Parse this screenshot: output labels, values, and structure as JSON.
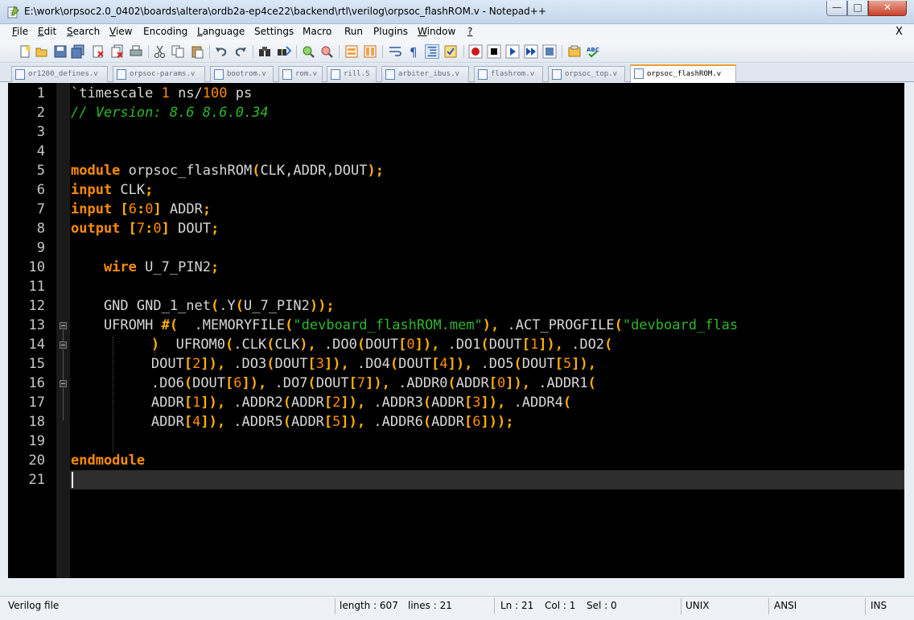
{
  "window": {
    "title": "E:\\work\\orpsoc2.0_0402\\boards\\altera\\ordb2a-ep4ce22\\backend\\rtl\\verilog\\orpsoc_flashROM.v - Notepad++",
    "min_label": "—",
    "max_label": "□",
    "close_label": "✕"
  },
  "menu": {
    "items": [
      {
        "u": "F",
        "rest": "ile"
      },
      {
        "u": "E",
        "rest": "dit"
      },
      {
        "u": "S",
        "rest": "earch"
      },
      {
        "u": "V",
        "rest": "iew"
      },
      {
        "u": "",
        "rest": "Encoding"
      },
      {
        "u": "L",
        "rest": "anguage"
      },
      {
        "u": "",
        "rest": "Settings"
      },
      {
        "u": "",
        "rest": "Macro"
      },
      {
        "u": "",
        "rest": "Run"
      },
      {
        "u": "",
        "rest": "Plugins"
      },
      {
        "u": "W",
        "rest": "indow"
      },
      {
        "u": "?",
        "rest": ""
      }
    ],
    "close": "X"
  },
  "tabs": [
    {
      "label": "or1200_defines.v"
    },
    {
      "label": "orpsoc-params.v"
    },
    {
      "label": "bootrom.v"
    },
    {
      "label": "rom.v"
    },
    {
      "label": "rill.S"
    },
    {
      "label": "arbiter_ibus.v"
    },
    {
      "label": "flashrom.v"
    },
    {
      "label": "orpsoc_top.v"
    },
    {
      "label": "orpsoc_flashROM.v"
    }
  ],
  "line_numbers": [
    "1",
    "2",
    "3",
    "4",
    "5",
    "6",
    "7",
    "8",
    "9",
    "10",
    "11",
    "12",
    "13",
    "14",
    "15",
    "16",
    "17",
    "18",
    "19",
    "20",
    "21"
  ],
  "code": {
    "l1": [
      [
        "`timescale ",
        "id"
      ],
      [
        "1",
        "num"
      ],
      [
        " ns/",
        "id"
      ],
      [
        "100",
        "num"
      ],
      [
        " ps",
        "id"
      ]
    ],
    "l2": [
      [
        "// Version: 8.6 8.6.0.34",
        "cmt"
      ]
    ],
    "l5": [
      [
        "module",
        "kw"
      ],
      [
        " orpsoc_flashROM",
        "id"
      ],
      [
        "(",
        "op"
      ],
      [
        "CLK,ADDR,DOUT",
        "id"
      ],
      [
        ")",
        "op"
      ],
      [
        ";",
        "op"
      ]
    ],
    "l6": [
      [
        "input",
        "kw"
      ],
      [
        " CLK",
        "id"
      ],
      [
        ";",
        "op"
      ]
    ],
    "l7": [
      [
        "input",
        "kw"
      ],
      [
        " ",
        "id"
      ],
      [
        "[",
        "op"
      ],
      [
        "6",
        "num"
      ],
      [
        ":",
        "op"
      ],
      [
        "0",
        "num"
      ],
      [
        "]",
        "op"
      ],
      [
        " ADDR",
        "id"
      ],
      [
        ";",
        "op"
      ]
    ],
    "l8": [
      [
        "output",
        "kw"
      ],
      [
        " ",
        "id"
      ],
      [
        "[",
        "op"
      ],
      [
        "7",
        "num"
      ],
      [
        ":",
        "op"
      ],
      [
        "0",
        "num"
      ],
      [
        "]",
        "op"
      ],
      [
        " DOUT",
        "id"
      ],
      [
        ";",
        "op"
      ]
    ],
    "l10": [
      [
        "    ",
        "id"
      ],
      [
        "wire",
        "kw"
      ],
      [
        " U_7_PIN2",
        "id"
      ],
      [
        ";",
        "op"
      ]
    ],
    "l12": [
      [
        "    GND GND_1_net",
        "id"
      ],
      [
        "(",
        "op"
      ],
      [
        ".Y",
        "id"
      ],
      [
        "(",
        "op"
      ],
      [
        "U_7_PIN2",
        "id"
      ],
      [
        "))",
        "op"
      ],
      [
        ";",
        "op"
      ]
    ],
    "l13": [
      [
        "    UFROMH ",
        "id"
      ],
      [
        "#(",
        "op"
      ],
      [
        "  .MEMORYFILE",
        "id"
      ],
      [
        "(",
        "op"
      ],
      [
        "\"devboard_flashROM.mem\"",
        "str"
      ],
      [
        "),",
        "op"
      ],
      [
        " .ACT_PROGFILE",
        "id"
      ],
      [
        "(",
        "op"
      ],
      [
        "\"devboard_flas",
        "str"
      ]
    ],
    "l14": [
      [
        "        ",
        "id"
      ],
      [
        ")",
        "op"
      ],
      [
        "  UFROM0",
        "id"
      ],
      [
        "(",
        "op"
      ],
      [
        ".CLK",
        "id"
      ],
      [
        "(",
        "op"
      ],
      [
        "CLK",
        "id"
      ],
      [
        "),",
        "op"
      ],
      [
        " .DO0",
        "id"
      ],
      [
        "(",
        "op"
      ],
      [
        "DOUT",
        "id"
      ],
      [
        "[",
        "op"
      ],
      [
        "0",
        "num"
      ],
      [
        "]",
        "op"
      ],
      [
        "),",
        "op"
      ],
      [
        " .DO1",
        "id"
      ],
      [
        "(",
        "op"
      ],
      [
        "DOUT",
        "id"
      ],
      [
        "[",
        "op"
      ],
      [
        "1",
        "num"
      ],
      [
        "]",
        "op"
      ],
      [
        "),",
        "op"
      ],
      [
        " .DO2",
        "id"
      ],
      [
        "(",
        "op"
      ]
    ],
    "l15": [
      [
        "        DOUT",
        "id"
      ],
      [
        "[",
        "op"
      ],
      [
        "2",
        "num"
      ],
      [
        "]",
        "op"
      ],
      [
        "),",
        "op"
      ],
      [
        " .DO3",
        "id"
      ],
      [
        "(",
        "op"
      ],
      [
        "DOUT",
        "id"
      ],
      [
        "[",
        "op"
      ],
      [
        "3",
        "num"
      ],
      [
        "]",
        "op"
      ],
      [
        "),",
        "op"
      ],
      [
        " .DO4",
        "id"
      ],
      [
        "(",
        "op"
      ],
      [
        "DOUT",
        "id"
      ],
      [
        "[",
        "op"
      ],
      [
        "4",
        "num"
      ],
      [
        "]",
        "op"
      ],
      [
        "),",
        "op"
      ],
      [
        " .DO5",
        "id"
      ],
      [
        "(",
        "op"
      ],
      [
        "DOUT",
        "id"
      ],
      [
        "[",
        "op"
      ],
      [
        "5",
        "num"
      ],
      [
        "]",
        "op"
      ],
      [
        "),",
        "op"
      ]
    ],
    "l16": [
      [
        "        .DO6",
        "id"
      ],
      [
        "(",
        "op"
      ],
      [
        "DOUT",
        "id"
      ],
      [
        "[",
        "op"
      ],
      [
        "6",
        "num"
      ],
      [
        "]",
        "op"
      ],
      [
        "),",
        "op"
      ],
      [
        " .DO7",
        "id"
      ],
      [
        "(",
        "op"
      ],
      [
        "DOUT",
        "id"
      ],
      [
        "[",
        "op"
      ],
      [
        "7",
        "num"
      ],
      [
        "]",
        "op"
      ],
      [
        "),",
        "op"
      ],
      [
        " .ADDR0",
        "id"
      ],
      [
        "(",
        "op"
      ],
      [
        "ADDR",
        "id"
      ],
      [
        "[",
        "op"
      ],
      [
        "0",
        "num"
      ],
      [
        "]",
        "op"
      ],
      [
        "),",
        "op"
      ],
      [
        " .ADDR1",
        "id"
      ],
      [
        "(",
        "op"
      ]
    ],
    "l17": [
      [
        "        ADDR",
        "id"
      ],
      [
        "[",
        "op"
      ],
      [
        "1",
        "num"
      ],
      [
        "]",
        "op"
      ],
      [
        "),",
        "op"
      ],
      [
        " .ADDR2",
        "id"
      ],
      [
        "(",
        "op"
      ],
      [
        "ADDR",
        "id"
      ],
      [
        "[",
        "op"
      ],
      [
        "2",
        "num"
      ],
      [
        "]",
        "op"
      ],
      [
        "),",
        "op"
      ],
      [
        " .ADDR3",
        "id"
      ],
      [
        "(",
        "op"
      ],
      [
        "ADDR",
        "id"
      ],
      [
        "[",
        "op"
      ],
      [
        "3",
        "num"
      ],
      [
        "]",
        "op"
      ],
      [
        "),",
        "op"
      ],
      [
        " .ADDR4",
        "id"
      ],
      [
        "(",
        "op"
      ]
    ],
    "l18": [
      [
        "        ADDR",
        "id"
      ],
      [
        "[",
        "op"
      ],
      [
        "4",
        "num"
      ],
      [
        "]",
        "op"
      ],
      [
        "),",
        "op"
      ],
      [
        " .ADDR5",
        "id"
      ],
      [
        "(",
        "op"
      ],
      [
        "ADDR",
        "id"
      ],
      [
        "[",
        "op"
      ],
      [
        "5",
        "num"
      ],
      [
        "]",
        "op"
      ],
      [
        "),",
        "op"
      ],
      [
        " .ADDR6",
        "id"
      ],
      [
        "(",
        "op"
      ],
      [
        "ADDR",
        "id"
      ],
      [
        "[",
        "op"
      ],
      [
        "6",
        "num"
      ],
      [
        "]",
        "op"
      ],
      [
        "))",
        "op"
      ],
      [
        ";",
        "op"
      ]
    ],
    "l20": [
      [
        "endmodule",
        "kw"
      ]
    ]
  },
  "status": {
    "filetype": "Verilog file",
    "length": "length : 607",
    "lines": "lines : 21",
    "ln": "Ln : 21",
    "col": "Col : 1",
    "sel": "Sel : 0",
    "eol": "UNIX",
    "encoding": "ANSI",
    "mode": "INS"
  }
}
